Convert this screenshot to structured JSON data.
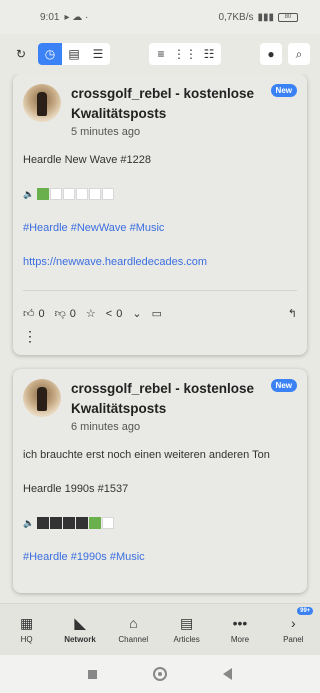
{
  "status": {
    "time": "9:01",
    "net": "0,7KB/s",
    "battery": "80"
  },
  "toolbar": {
    "icons": [
      "refresh-icon",
      "clock-icon",
      "chat-icon",
      "list-icon",
      "text-lines-icon",
      "grid-icon",
      "cards-icon",
      "person-icon",
      "search-icon"
    ]
  },
  "posts": [
    {
      "author": "crossgolf_rebel - kostenlose Kwalitätsposts",
      "time": "5 minutes ago",
      "badge": "New",
      "lines": [
        "Heardle New Wave #1228"
      ],
      "squares": [
        "g",
        "e",
        "e",
        "e",
        "e",
        "e"
      ],
      "tags": "#Heardle #NewWave #Music",
      "link": "https://newwave.heardledecades.com",
      "likes": "0",
      "dislikes": "0",
      "shares": "0"
    },
    {
      "author": "crossgolf_rebel - kostenlose Kwalitätsposts",
      "time": "6 minutes ago",
      "badge": "New",
      "lines": [
        "ich brauchte erst noch einen weiteren anderen Ton",
        "Heardle 1990s #1537"
      ],
      "squares": [
        "d",
        "d",
        "d",
        "d",
        "g",
        "e"
      ],
      "tags": "#Heardle #1990s #Music"
    }
  ],
  "nav": {
    "hq": "HQ",
    "network": "Network",
    "channel": "Channel",
    "articles": "Articles",
    "more": "More",
    "panel": "Panel",
    "panel_badge": "99+"
  },
  "colors": {
    "accent": "#3b82f6",
    "green": "#6ab04c",
    "link": "#3b6fe0"
  }
}
